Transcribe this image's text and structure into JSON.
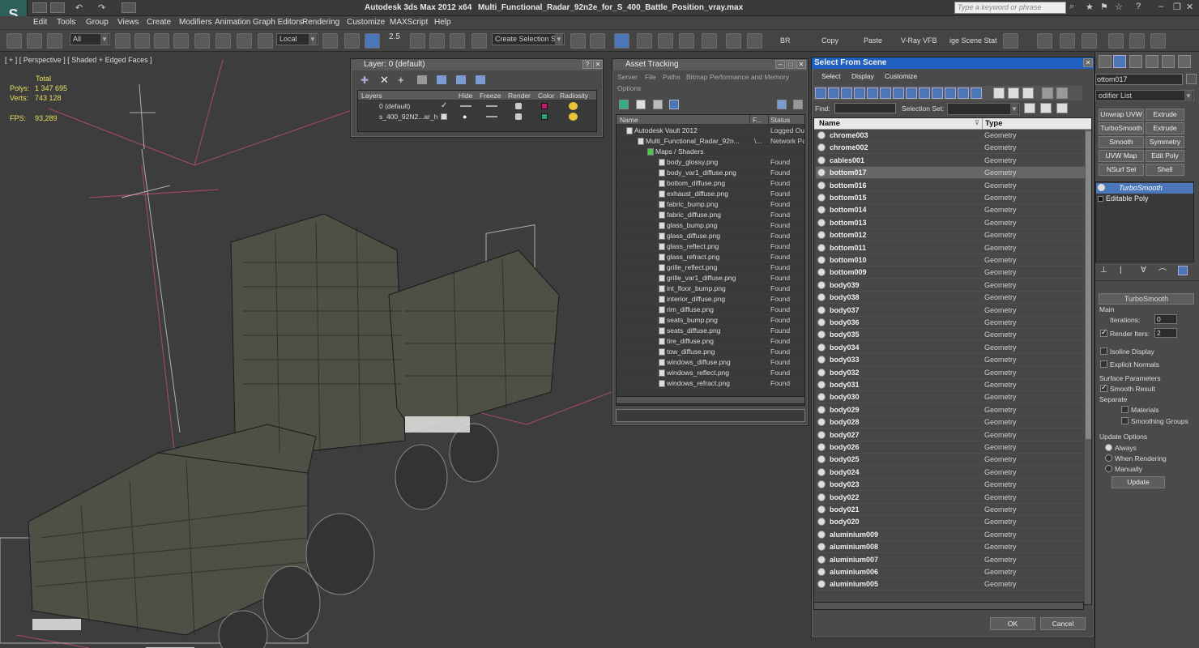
{
  "app": {
    "title": "Autodesk 3ds Max  2012 x64",
    "file": "Multi_Functional_Radar_92n2e_for_S_400_Battle_Position_vray.max",
    "search_placeholder": "Type a keyword or phrase"
  },
  "menu": [
    "Edit",
    "Tools",
    "Group",
    "Views",
    "Create",
    "Modifiers",
    "Animation",
    "Graph Editors",
    "Rendering",
    "Customize",
    "MAXScript",
    "Help"
  ],
  "toolbar": {
    "filter": "All",
    "coord": "Local",
    "selset": "Create Selection Se",
    "br": "BR",
    "copy": "Copy",
    "paste": "Paste",
    "vray": "V-Ray VFB",
    "scene": "ige Scene Stat",
    "num": "2.5"
  },
  "viewport": {
    "label": "[ + ] [ Perspective ] [ Shaded + Edged Faces ]",
    "total": "Total",
    "polys_label": "Polys:",
    "polys": "1 347 695",
    "verts_label": "Verts:",
    "verts": "743 128",
    "fps_label": "FPS:",
    "fps": "93,289"
  },
  "layer": {
    "title": "Layer: 0 (default)",
    "headers": [
      "Layers",
      "Hide",
      "Freeze",
      "Render",
      "Color",
      "Radiosity"
    ],
    "rows": [
      {
        "name": "0 (default)",
        "color": "#c8186e"
      },
      {
        "name": "s_400_92N2...ar_h",
        "color": "#1fa88a"
      }
    ]
  },
  "asset": {
    "title": "Asset Tracking",
    "menu": [
      "Server",
      "File",
      "Paths",
      "Bitmap Performance and Memory"
    ],
    "options": "Options",
    "headers": [
      "Name",
      "F...",
      "Status"
    ],
    "rows": [
      {
        "name": "Autodesk Vault 2012",
        "f": "",
        "status": "Logged Out"
      },
      {
        "name": "Multi_Functional_Radar_92n...",
        "f": "\\...",
        "status": "Network Pa"
      },
      {
        "name": "Maps / Shaders",
        "f": "",
        "status": ""
      },
      {
        "name": "body_glossy.png",
        "f": "",
        "status": "Found"
      },
      {
        "name": "body_var1_diffuse.png",
        "f": "",
        "status": "Found"
      },
      {
        "name": "bottom_diffuse.png",
        "f": "",
        "status": "Found"
      },
      {
        "name": "exhaust_diffuse.png",
        "f": "",
        "status": "Found"
      },
      {
        "name": "fabric_bump.png",
        "f": "",
        "status": "Found"
      },
      {
        "name": "fabric_diffuse.png",
        "f": "",
        "status": "Found"
      },
      {
        "name": "glass_bump.png",
        "f": "",
        "status": "Found"
      },
      {
        "name": "glass_diffuse.png",
        "f": "",
        "status": "Found"
      },
      {
        "name": "glass_reflect.png",
        "f": "",
        "status": "Found"
      },
      {
        "name": "glass_refract.png",
        "f": "",
        "status": "Found"
      },
      {
        "name": "grille_reflect.png",
        "f": "",
        "status": "Found"
      },
      {
        "name": "grille_var1_diffuse.png",
        "f": "",
        "status": "Found"
      },
      {
        "name": "int_floor_bump.png",
        "f": "",
        "status": "Found"
      },
      {
        "name": "interior_diffuse.png",
        "f": "",
        "status": "Found"
      },
      {
        "name": "rim_diffuse.png",
        "f": "",
        "status": "Found"
      },
      {
        "name": "seats_bump.png",
        "f": "",
        "status": "Found"
      },
      {
        "name": "seats_diffuse.png",
        "f": "",
        "status": "Found"
      },
      {
        "name": "tire_diffuse.png",
        "f": "",
        "status": "Found"
      },
      {
        "name": "tow_diffuse.png",
        "f": "",
        "status": "Found"
      },
      {
        "name": "windows_diffuse.png",
        "f": "",
        "status": "Found"
      },
      {
        "name": "windows_reflect.png",
        "f": "",
        "status": "Found"
      },
      {
        "name": "windows_refract.png",
        "f": "",
        "status": "Found"
      }
    ]
  },
  "sfs": {
    "title": "Select From Scene",
    "menu": [
      "Select",
      "Display",
      "Customize"
    ],
    "find_label": "Find:",
    "selset_label": "Selection Set:",
    "headers": [
      "Name",
      "Type"
    ],
    "rows": [
      {
        "name": "chrome003",
        "type": "Geometry"
      },
      {
        "name": "chrome002",
        "type": "Geometry"
      },
      {
        "name": "cables001",
        "type": "Geometry"
      },
      {
        "name": "bottom017",
        "type": "Geometry"
      },
      {
        "name": "bottom016",
        "type": "Geometry"
      },
      {
        "name": "bottom015",
        "type": "Geometry"
      },
      {
        "name": "bottom014",
        "type": "Geometry"
      },
      {
        "name": "bottom013",
        "type": "Geometry"
      },
      {
        "name": "bottom012",
        "type": "Geometry"
      },
      {
        "name": "bottom011",
        "type": "Geometry"
      },
      {
        "name": "bottom010",
        "type": "Geometry"
      },
      {
        "name": "bottom009",
        "type": "Geometry"
      },
      {
        "name": "body039",
        "type": "Geometry"
      },
      {
        "name": "body038",
        "type": "Geometry"
      },
      {
        "name": "body037",
        "type": "Geometry"
      },
      {
        "name": "body036",
        "type": "Geometry"
      },
      {
        "name": "body035",
        "type": "Geometry"
      },
      {
        "name": "body034",
        "type": "Geometry"
      },
      {
        "name": "body033",
        "type": "Geometry"
      },
      {
        "name": "body032",
        "type": "Geometry"
      },
      {
        "name": "body031",
        "type": "Geometry"
      },
      {
        "name": "body030",
        "type": "Geometry"
      },
      {
        "name": "body029",
        "type": "Geometry"
      },
      {
        "name": "body028",
        "type": "Geometry"
      },
      {
        "name": "body027",
        "type": "Geometry"
      },
      {
        "name": "body026",
        "type": "Geometry"
      },
      {
        "name": "body025",
        "type": "Geometry"
      },
      {
        "name": "body024",
        "type": "Geometry"
      },
      {
        "name": "body023",
        "type": "Geometry"
      },
      {
        "name": "body022",
        "type": "Geometry"
      },
      {
        "name": "body021",
        "type": "Geometry"
      },
      {
        "name": "body020",
        "type": "Geometry"
      },
      {
        "name": "aluminium009",
        "type": "Geometry"
      },
      {
        "name": "aluminium008",
        "type": "Geometry"
      },
      {
        "name": "aluminium007",
        "type": "Geometry"
      },
      {
        "name": "aluminium006",
        "type": "Geometry"
      },
      {
        "name": "aluminium005",
        "type": "Geometry"
      }
    ],
    "selected": "bottom017",
    "ok": "OK",
    "cancel": "Cancel"
  },
  "cmd": {
    "object_name": "ottom017",
    "modifier_list": "odifier List",
    "buttons": [
      "Unwrap UVW",
      "Extrude",
      "TurboSmooth",
      "Extrude",
      "Smooth",
      "Symmetry",
      "UVW Map",
      "Edit Poly",
      "NSurf Sel",
      "Shell"
    ],
    "stack": [
      "TurboSmooth",
      "Editable Poly"
    ],
    "rollout_title": "TurboSmooth",
    "main": "Main",
    "iterations_label": "Iterations:",
    "iterations": "0",
    "render_iters_label": "Render Iters:",
    "render_iters": "2",
    "isoline": "Isoline Display",
    "explicit": "Explicit Normals",
    "surface_params": "Surface Parameters",
    "smooth_result": "Smooth Result",
    "separate": "Separate",
    "materials": "Materials",
    "smoothing_groups": "Smoothing Groups",
    "update_options": "Update Options",
    "always": "Always",
    "when_rendering": "When Rendering",
    "manually": "Manually",
    "update": "Update"
  }
}
